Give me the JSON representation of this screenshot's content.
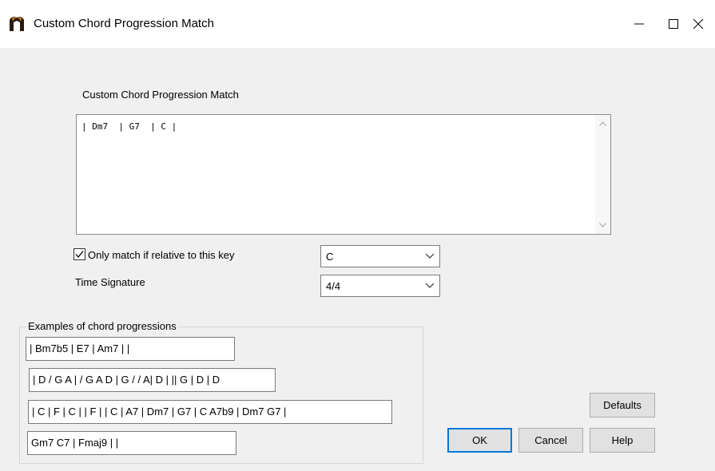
{
  "window": {
    "title": "Custom Chord Progression Match"
  },
  "progression": {
    "label": "Custom Chord Progression Match",
    "value": "| Dm7  | G7  | C |"
  },
  "key_match": {
    "checked": true,
    "label": "Only match if relative to this  key",
    "value": "C"
  },
  "time_signature": {
    "label": "Time Signature",
    "value": "4/4"
  },
  "examples": {
    "title": "Examples of chord progressions",
    "items": [
      "| Bm7b5 | E7 | Am7 |   |",
      "| D / G A | / G A D | G / / A| D |  || G  | D |  D",
      "| C | F | C |  | F  |   | C | A7 | Dm7 | G7 | C A7b9 | Dm7 G7 |",
      "Gm7 C7 | Fmaj9 |   |"
    ]
  },
  "buttons": {
    "defaults": "Defaults",
    "ok": "OK",
    "cancel": "Cancel",
    "help": "Help"
  },
  "icons": {
    "app": "app-icon",
    "minimize": "minimize-icon",
    "maximize": "maximize-icon",
    "close": "close-icon"
  },
  "colors": {
    "focus_border": "#0078d7"
  }
}
